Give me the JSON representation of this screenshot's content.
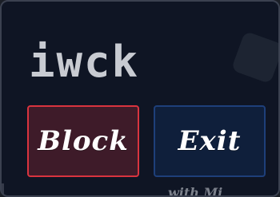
{
  "title": "iwck",
  "buttons": {
    "block_label": "Block",
    "exit_label": "Exit"
  },
  "footer": {
    "text": "with Mi"
  },
  "colors": {
    "background": "#0f1524",
    "frame_border": "#3b4150",
    "title_text": "#c8cbd2",
    "block_border": "#d9343f",
    "block_fill": "#3e1b29",
    "exit_border": "#1e3f7a",
    "exit_fill": "#0f1f3b"
  }
}
